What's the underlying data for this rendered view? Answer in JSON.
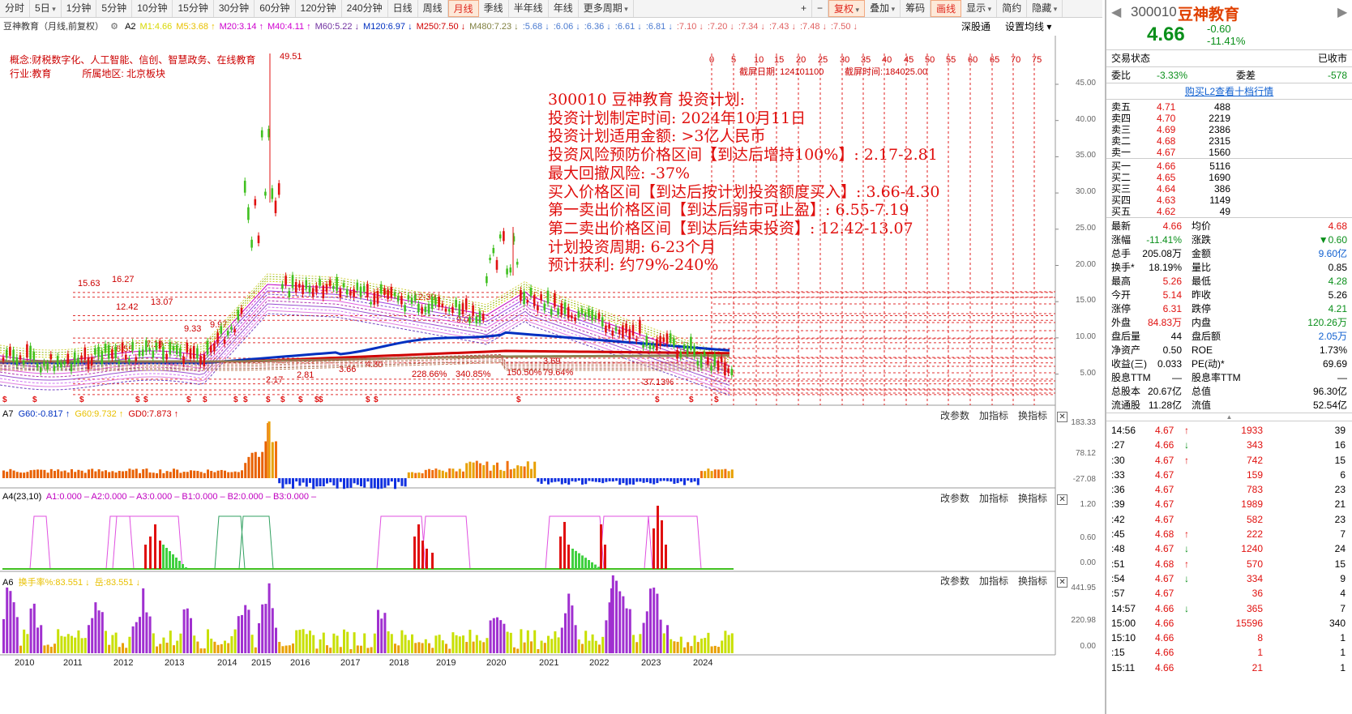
{
  "toolbar": {
    "items": [
      "分时",
      "5日",
      "1分钟",
      "5分钟",
      "10分钟",
      "15分钟",
      "30分钟",
      "60分钟",
      "120分钟",
      "240分钟",
      "日线",
      "周线",
      "月线",
      "季线",
      "半年线",
      "年线",
      "更多周期"
    ],
    "active": "月线",
    "right_items": [
      "+",
      "−",
      "复权",
      "叠加",
      "筹码",
      "画线",
      "显示",
      "简约",
      "隐藏"
    ]
  },
  "infobar": {
    "stock": "豆神教育（月线,前复权）",
    "items": [
      {
        "t": "A2",
        "c": "#000"
      },
      {
        "t": "M1:4.66",
        "c": "#d8d800"
      },
      {
        "t": "M5:3.68 ↑",
        "c": "#e8c000"
      },
      {
        "t": "M20:3.14 ↑",
        "c": "#cc00cc"
      },
      {
        "t": "M40:4.11 ↑",
        "c": "#d000d0"
      },
      {
        "t": "M60:5.22 ↓",
        "c": "#7030a0"
      },
      {
        "t": "M120:6.97 ↓",
        "c": "#0030c0"
      },
      {
        "t": "M250:7.50 ↓",
        "c": "#d00000"
      },
      {
        "t": "M480:7.23 ↓",
        "c": "#808040"
      },
      {
        "t": ":5.68 ↓",
        ":": "",
        "c": "#4a7ad0"
      },
      {
        "t": ":6.06 ↓",
        "c": "#4a7ad0"
      },
      {
        "t": ":6.36 ↓",
        "c": "#4a7ad0"
      },
      {
        "t": ":6.61 ↓",
        "c": "#4a7ad0"
      },
      {
        "t": ":6.81 ↓",
        "c": "#4a7ad0"
      },
      {
        "t": ":7.10 ↓",
        "c": "#e06060"
      },
      {
        "t": ":7.20 ↓",
        "c": "#e06060"
      },
      {
        "t": ":7.34 ↓",
        "c": "#e06060"
      },
      {
        "t": ":7.43 ↓",
        "c": "#e06060"
      },
      {
        "t": ":7.48 ↓",
        "c": "#e06060"
      },
      {
        "t": ":7.50 ↓",
        "c": "#e06060"
      }
    ],
    "shenzhen": "深股通",
    "set_ma": "设置均线"
  },
  "concept": {
    "line1": "概念:财税数字化、人工智能、信创、智慧政务、在线教育",
    "line2_a": "行业:教育",
    "line2_b": "所属地区: 北京板块"
  },
  "plan": [
    "300010 豆神教育 投资计划:",
    "投资计划制定时间: 2024年10月11日",
    "投资计划适用金额: >3亿人民币",
    "投资风险预防价格区间【到达后增持100%】: 2.17-2.81",
    "最大回撤风险: -37%",
    "买入价格区间【到达后按计划投资额度买入】: 3.66-4.30",
    "第一卖出价格区间【到达后弱市可止盈】: 6.55-7.19",
    "第二卖出价格区间【到达后结束投资】: 12.42-13.07",
    "计划投资周期: 6-23个月",
    "预计获利: 约79%-240%"
  ],
  "shot": {
    "date_label": "截屏日期",
    "date": "124101100",
    "time_label": "截屏时间",
    "time": "184025.00"
  },
  "fib_nums": [
    "0",
    "5",
    "10",
    "15",
    "20",
    "25",
    "30",
    "35",
    "40",
    "45",
    "50",
    "55",
    "60",
    "65",
    "70",
    "75"
  ],
  "price_axis": [
    "45.00",
    "40.00",
    "35.00",
    "30.00",
    "25.00",
    "20.00",
    "15.00",
    "10.00",
    "5.00"
  ],
  "levels": [
    {
      "label": "15.63",
      "v": 15.63
    },
    {
      "label": "16.27",
      "v": 16.27
    },
    {
      "label": "12.42",
      "v": 12.42
    },
    {
      "label": "13.07",
      "v": 13.07
    },
    {
      "label": "9.33",
      "v": 9.33
    },
    {
      "label": "9.97",
      "v": 9.97
    },
    {
      "label": "6.55",
      "v": 6.55
    },
    {
      "label": "7.19",
      "v": 7.19
    },
    {
      "label": "2.17",
      "v": 2.17
    },
    {
      "label": "2.81",
      "v": 2.81
    },
    {
      "label": "3.66",
      "v": 3.66
    },
    {
      "label": "4.30",
      "v": 4.3
    }
  ],
  "chart_notes": {
    "peak": "49.51",
    "n1": "12.39",
    "n2": "9.06",
    "n3": "3.69",
    "p1": "228.66%",
    "p2": "340.85%",
    "p3": "150.50%",
    "p4": "79.64%",
    "p5": "-37.13%"
  },
  "panel_a7": {
    "title": "A7",
    "g60": "G60:-0.817 ↑",
    "g60b": "G60:9.732 ↑",
    "gd0": "GD0:7.873 ↑",
    "axis": [
      "183.33",
      "78.12",
      "-27.08"
    ]
  },
  "panel_a4": {
    "title": "A4(23,10)",
    "vals": "A1:0.000 – A2:0.000 – A3:0.000 – B1:0.000 – B2:0.000 – B3:0.000 –",
    "axis": [
      "1.20",
      "0.60",
      "0.00"
    ]
  },
  "panel_a6": {
    "title": "A6",
    "h1": "换手率%:83.551 ↓",
    "h2": "岳:83.551 ↓",
    "axis": [
      "441.95",
      "220.98",
      "0.00"
    ]
  },
  "panel_btns": [
    "改参数",
    "加指标",
    "换指标"
  ],
  "years": [
    "2010",
    "2011",
    "2012",
    "2013",
    "2014",
    "2015",
    "2016",
    "2017",
    "2018",
    "2019",
    "2020",
    "2021",
    "2022",
    "2023",
    "2024"
  ],
  "quote": {
    "code": "300010",
    "name": "豆神教育",
    "price": "4.66",
    "change": "-0.60",
    "pct": "-11.41%",
    "status_label": "交易状态",
    "status": "已收市",
    "wb_label": "委比",
    "wb": "-3.33%",
    "wc_label": "委差",
    "wc": "-578",
    "l2": "购买L2查看十档行情",
    "asks": [
      [
        "卖五",
        "4.71",
        "488"
      ],
      [
        "卖四",
        "4.70",
        "2219"
      ],
      [
        "卖三",
        "4.69",
        "2386"
      ],
      [
        "卖二",
        "4.68",
        "2315"
      ],
      [
        "卖一",
        "4.67",
        "1560"
      ]
    ],
    "bids": [
      [
        "买一",
        "4.66",
        "5116"
      ],
      [
        "买二",
        "4.65",
        "1690"
      ],
      [
        "买三",
        "4.64",
        "386"
      ],
      [
        "买四",
        "4.63",
        "1149"
      ],
      [
        "买五",
        "4.62",
        "49"
      ]
    ],
    "stats": [
      [
        "最新",
        "4.66",
        "red",
        "均价",
        "4.68",
        "red"
      ],
      [
        "涨幅",
        "-11.41%",
        "green",
        "涨跌",
        "▼0.60",
        "green"
      ],
      [
        "总手",
        "205.08万",
        "black",
        "金额",
        "9.60亿",
        "blue"
      ],
      [
        "换手*",
        "18.19%",
        "black",
        "量比",
        "0.85",
        "black"
      ],
      [
        "最高",
        "5.26",
        "red",
        "最低",
        "4.28",
        "green"
      ],
      [
        "今开",
        "5.14",
        "red",
        "昨收",
        "5.26",
        "black"
      ],
      [
        "涨停",
        "6.31",
        "red",
        "跌停",
        "4.21",
        "green"
      ],
      [
        "外盘",
        "84.83万",
        "red",
        "内盘",
        "120.26万",
        "green"
      ],
      [
        "盘后量",
        "44",
        "black",
        "盘后额",
        "2.05万",
        "blue"
      ],
      [
        "净资产",
        "0.50",
        "black",
        "ROE",
        "1.73%",
        "black"
      ],
      [
        "收益(三)",
        "0.033",
        "black",
        "PE(动)*",
        "69.69",
        "black"
      ],
      [
        "股息TTM",
        "—",
        "black",
        "股息率TTM",
        "—",
        "black"
      ],
      [
        "总股本",
        "20.67亿",
        "black",
        "总值",
        "96.30亿",
        "black"
      ],
      [
        "流通股",
        "11.28亿",
        "black",
        "流值",
        "52.54亿",
        "black"
      ]
    ],
    "ticks": [
      [
        "14:56",
        "4.67",
        "↑",
        "1933",
        "39"
      ],
      [
        ":27",
        "4.66",
        "↓",
        "343",
        "16"
      ],
      [
        ":30",
        "4.67",
        "↑",
        "742",
        "15"
      ],
      [
        ":33",
        "4.67",
        "",
        "159",
        "6"
      ],
      [
        ":36",
        "4.67",
        "",
        "783",
        "23"
      ],
      [
        ":39",
        "4.67",
        "",
        "1989",
        "21"
      ],
      [
        ":42",
        "4.67",
        "",
        "582",
        "23"
      ],
      [
        ":45",
        "4.68",
        "↑",
        "222",
        "7"
      ],
      [
        ":48",
        "4.67",
        "↓",
        "1240",
        "24"
      ],
      [
        ":51",
        "4.68",
        "↑",
        "570",
        "15"
      ],
      [
        ":54",
        "4.67",
        "↓",
        "334",
        "9"
      ],
      [
        ":57",
        "4.67",
        "",
        "36",
        "4"
      ],
      [
        "14:57",
        "4.66",
        "↓",
        "365",
        "7"
      ],
      [
        "15:00",
        "4.66",
        "",
        "15596",
        "340"
      ],
      [
        "15:10",
        "4.66",
        "",
        "8",
        "1"
      ],
      [
        ":15",
        "4.66",
        "",
        "1",
        "1"
      ],
      [
        "15:11",
        "4.66",
        "",
        "21",
        "1"
      ]
    ]
  }
}
